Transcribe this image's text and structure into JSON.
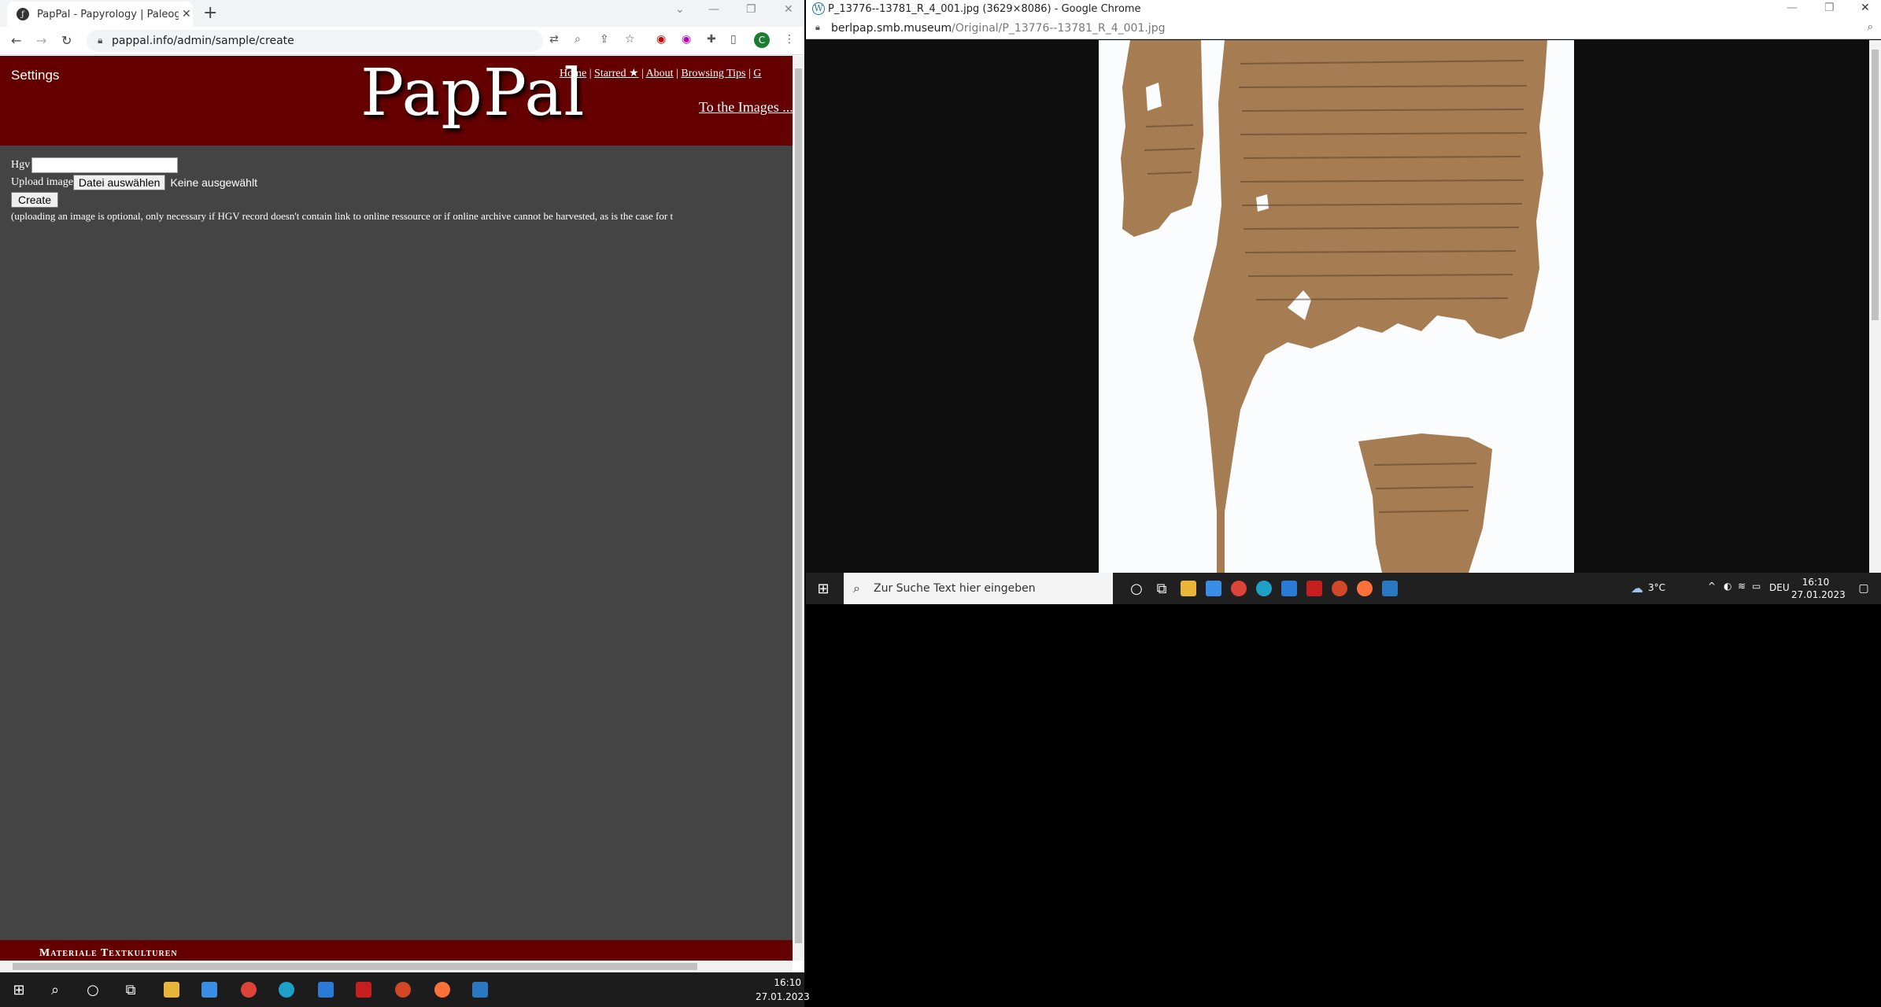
{
  "left_browser": {
    "tab_title": "PapPal - Papyrology | Paleograph",
    "url": "pappal.info/admin/sample/create",
    "profile_initial": "C",
    "page": {
      "settings_label": "Settings",
      "logo": "PapPal",
      "nav": {
        "home": "Home",
        "starred": "Starred ★",
        "about": "About",
        "browsing_tips": "Browsing Tips",
        "separator": "|",
        "overflow": "G"
      },
      "to_images": "To the Images ...",
      "form": {
        "hgv_label": "Hgv",
        "hgv_value": "",
        "upload_label": "Upload image",
        "file_button": "Datei auswählen",
        "file_status": "Keine ausgewählt",
        "create_button": "Create"
      },
      "note": "(uploading an image is optional, only necessary if HGV record doesn't contain link to online ressource or if online archive cannot be harvested, as is the case for t",
      "footer": "Materiale Textkulturen"
    }
  },
  "left_taskbar": {
    "time": "16:10",
    "date": "27.01.2023"
  },
  "right_browser": {
    "window_title": "P_13776--13781_R_4_001.jpg (3629×8086) - Google Chrome",
    "url_host": "berlpap.smb.museum",
    "url_path": "/Original/P_13776--13781_R_4_001.jpg"
  },
  "right_taskbar": {
    "search_placeholder": "Zur Suche Text hier eingeben",
    "weather": "3°C",
    "language": "DEU",
    "time": "16:10",
    "date": "27.01.2023"
  },
  "colors": {
    "header_red": "#650000",
    "page_bg": "#444444",
    "papyrus": "#a67c52"
  }
}
